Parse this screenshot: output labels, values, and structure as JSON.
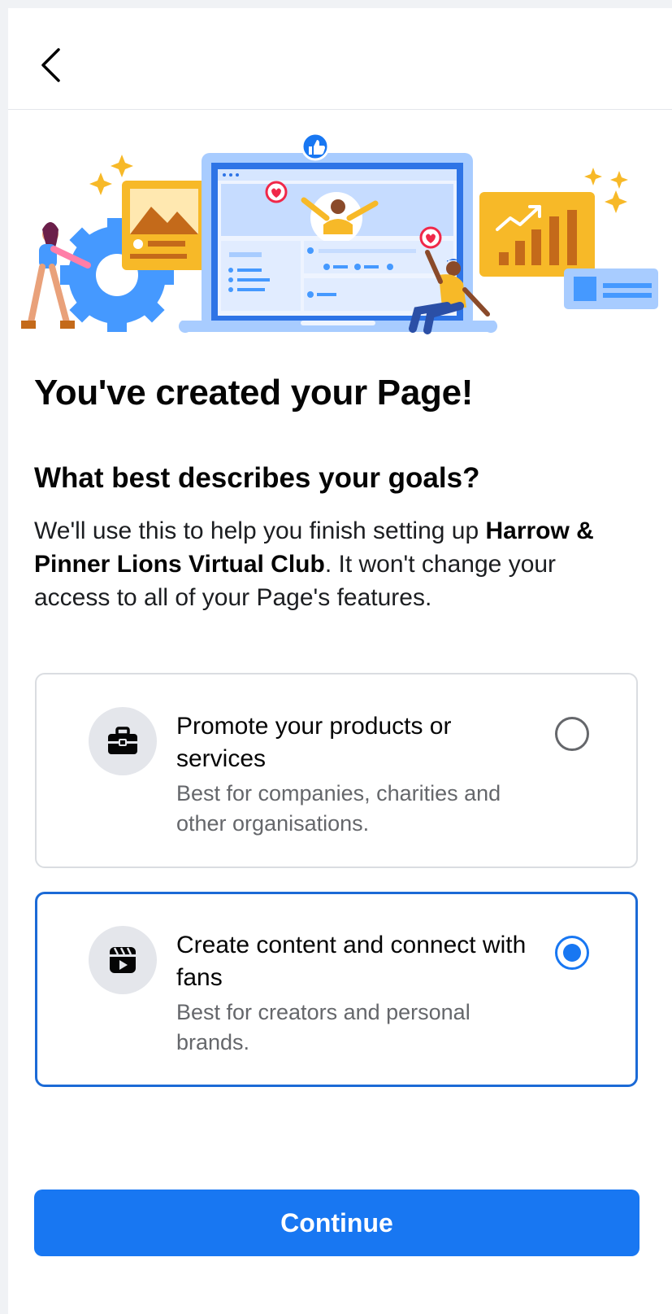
{
  "header": {
    "back_icon": "chevron-left-icon"
  },
  "main": {
    "title": "You've created your Page!",
    "subtitle": "What best describes your goals?",
    "description_prefix": "We'll use this to help you finish setting up ",
    "page_name": "Harrow & Pinner Lions Virtual Club",
    "description_suffix": ". It won't change your access to all of your Page's features."
  },
  "options": [
    {
      "icon": "briefcase-icon",
      "title": "Promote your products or services",
      "description": "Best for companies, charities and other organisations.",
      "selected": false
    },
    {
      "icon": "reels-clapper-icon",
      "title": "Create content and connect with fans",
      "description": "Best for creators and personal brands.",
      "selected": true
    }
  ],
  "footer": {
    "continue_label": "Continue"
  },
  "colors": {
    "accent": "#1877f2",
    "selected_border": "#1b6ad6",
    "muted_text": "#65676b"
  }
}
